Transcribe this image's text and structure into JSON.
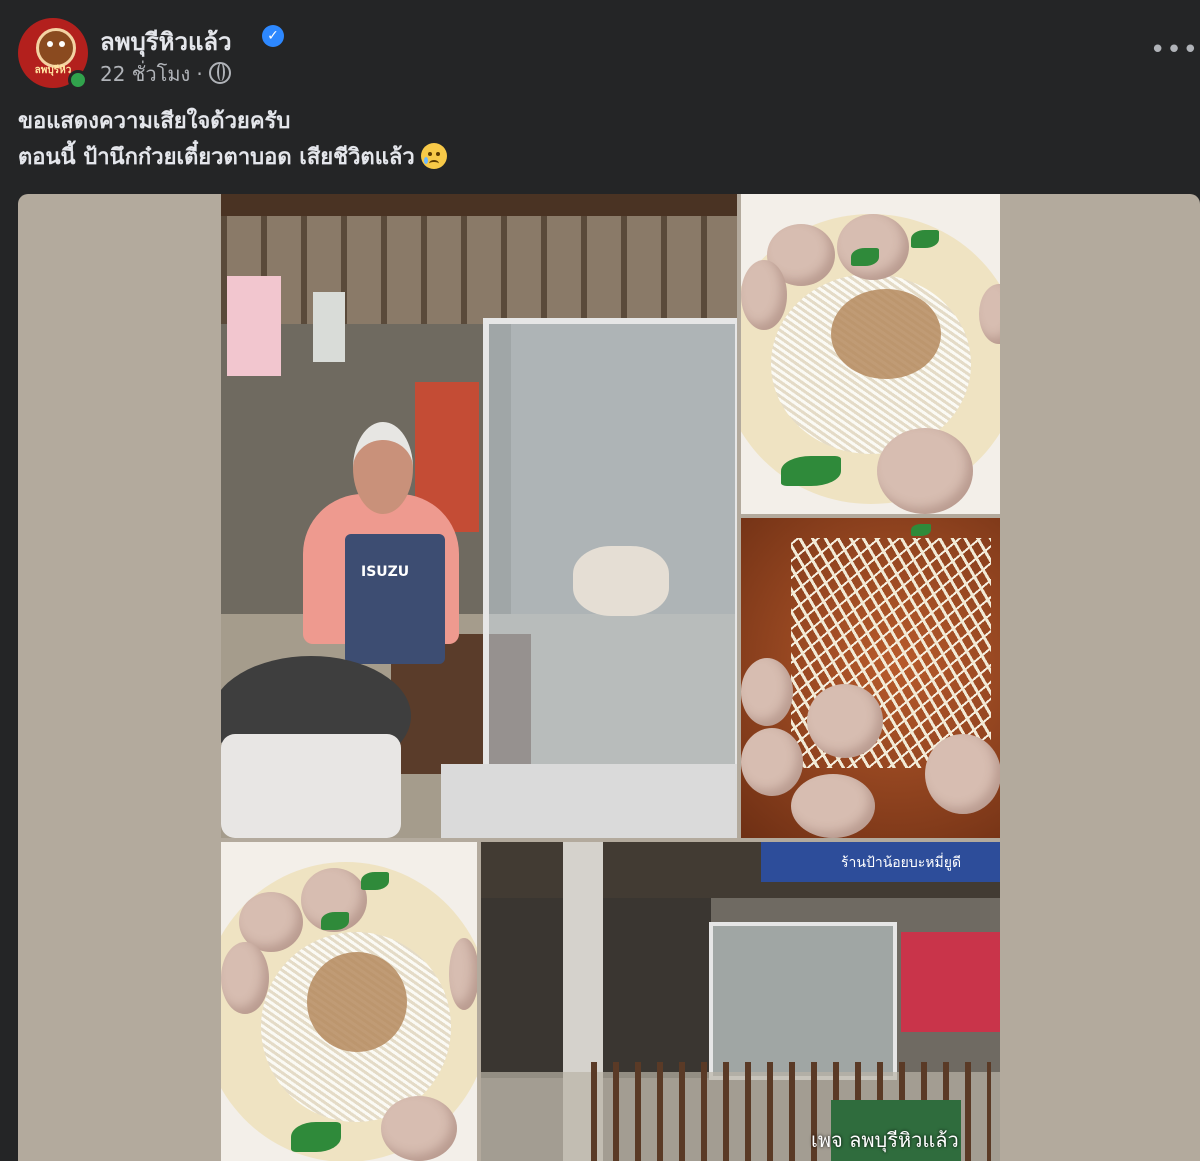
{
  "post": {
    "page_name": "ลพบุรีหิวแล้ว",
    "avatar_caption": "ลพบุรีหิว",
    "time": "22 ชั่วโมง",
    "separator": "·",
    "more_label": "•••",
    "text_line1": "ขอแสดงความเสียใจด้วยครับ",
    "text_line2": "ตอนนี้ ป้านึกก๋วยเตี๋ยวตาบอด เสียชีวิตแล้ว"
  },
  "icons": {
    "verified": "verified-badge-icon",
    "audience": "globe-icon",
    "more": "more-options-icon",
    "emoji": "sad-tear-emoji"
  },
  "photos": {
    "apron_text": "ISUZU",
    "shop_sign": "ร้านป้าน้อยบะหมี่ยูดี",
    "watermark": "เพจ ลพบุรีหิวแล้ว"
  },
  "colors": {
    "background": "#242526",
    "text_primary": "#e4e6eb",
    "text_secondary": "#b0b3b8",
    "verified": "#2d88ff",
    "online": "#31a24c",
    "media_bg": "#b3aa9d"
  }
}
